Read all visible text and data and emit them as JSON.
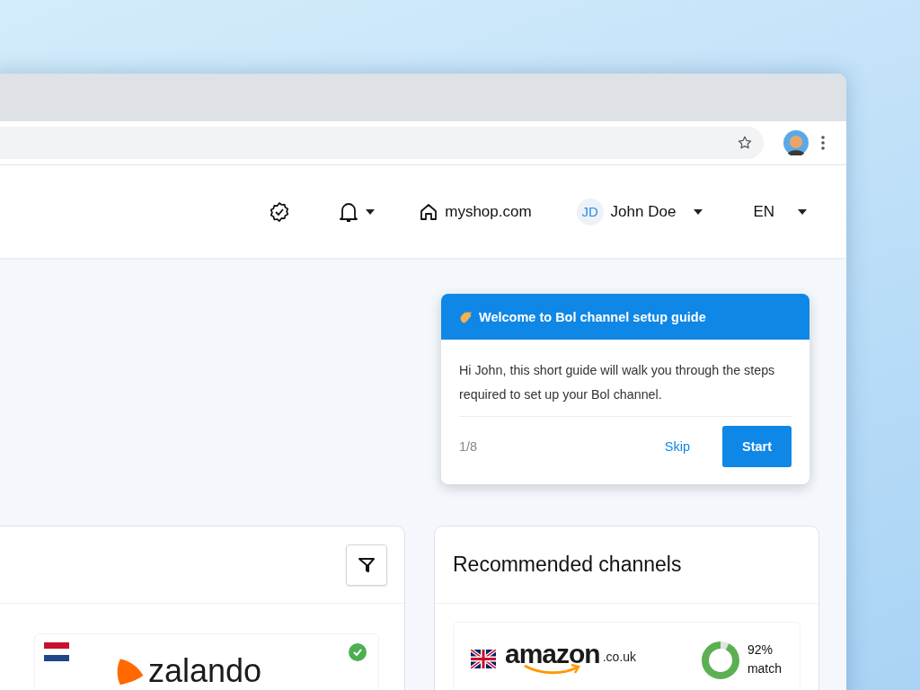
{
  "header": {
    "site": "myshop.com",
    "user": {
      "initials": "JD",
      "name": "John Doe"
    },
    "language": "EN"
  },
  "tour": {
    "title": "Welcome to Bol channel setup guide",
    "body": "Hi John, this short guide will walk you through the steps required to set up your Bol channel.",
    "step": "1/8",
    "skip": "Skip",
    "start": "Start"
  },
  "channels": [
    {
      "logo": "zalando",
      "connected": true
    }
  ],
  "recommended": {
    "title": "Recommended channels",
    "items": [
      {
        "logo": "amazon",
        "domain": ".co.uk",
        "level": 0.92,
        "match": "92%",
        "match_label": "match"
      }
    ]
  }
}
